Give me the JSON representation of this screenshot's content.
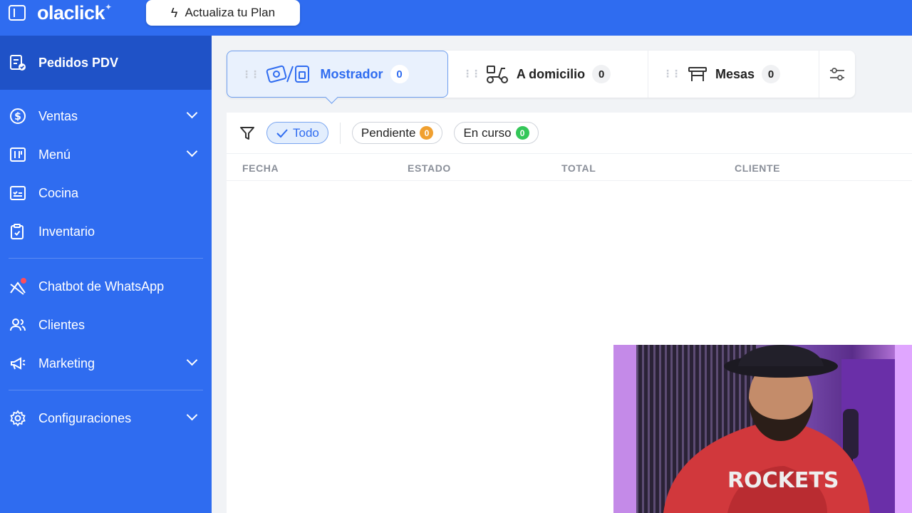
{
  "app": {
    "logo": "olaclick",
    "upgrade_label": "Actualiza tu Plan"
  },
  "sidebar": {
    "active": {
      "label": "Pedidos PDV",
      "icon": "orders-icon"
    },
    "group1": [
      {
        "label": "Ventas",
        "icon": "dollar-icon",
        "expandable": true
      },
      {
        "label": "Menú",
        "icon": "menu-book-icon",
        "expandable": true
      },
      {
        "label": "Cocina",
        "icon": "kitchen-icon",
        "expandable": false
      },
      {
        "label": "Inventario",
        "icon": "clipboard-icon",
        "expandable": false
      }
    ],
    "group2": [
      {
        "label": "Chatbot de WhatsApp",
        "icon": "chatbot-icon",
        "expandable": false
      },
      {
        "label": "Clientes",
        "icon": "users-icon",
        "expandable": false
      },
      {
        "label": "Marketing",
        "icon": "megaphone-icon",
        "expandable": true
      }
    ],
    "group3": [
      {
        "label": "Configuraciones",
        "icon": "gear-icon",
        "expandable": true
      }
    ]
  },
  "tabs": [
    {
      "label": "Mostrador",
      "count": "0",
      "active": true,
      "icon": "counter-icon"
    },
    {
      "label": "A domicilio",
      "count": "0",
      "active": false,
      "icon": "scooter-icon"
    },
    {
      "label": "Mesas",
      "count": "0",
      "active": false,
      "icon": "table-icon"
    }
  ],
  "filters": {
    "todo": "Todo",
    "pendiente": {
      "label": "Pendiente",
      "count": "0",
      "color": "#f0a030"
    },
    "en_curso": {
      "label": "En curso",
      "count": "0",
      "color": "#34c759"
    }
  },
  "table": {
    "columns": [
      "FECHA",
      "ESTADO",
      "TOTAL",
      "CLIENTE"
    ]
  },
  "colors": {
    "primary": "#2f6cf0",
    "sidebar_active": "#1f52c7"
  }
}
